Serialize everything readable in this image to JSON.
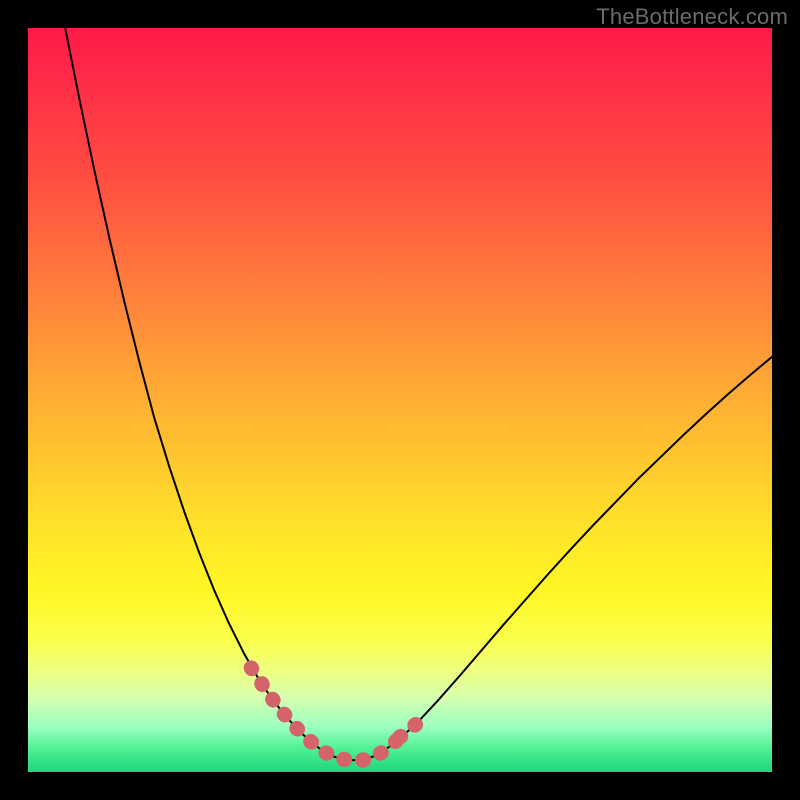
{
  "watermark": {
    "text": "TheBottleneck.com"
  },
  "colors": {
    "background": "#000000",
    "curve_stroke": "#000000",
    "highlight_stroke": "#d4646a",
    "gradient_top": "#ff1a49",
    "gradient_bottom": "#1fd47c"
  },
  "chart_data": {
    "type": "line",
    "title": "",
    "xlabel": "",
    "ylabel": "",
    "xlim": [
      0,
      100
    ],
    "ylim": [
      0,
      100
    ],
    "x": [
      5,
      7,
      9,
      11,
      13,
      15,
      17,
      19,
      21,
      23,
      25,
      27,
      29,
      31,
      32,
      33,
      34,
      35,
      36,
      37,
      38,
      39,
      40,
      41,
      42,
      43,
      45,
      47,
      49,
      52,
      55,
      58,
      61,
      64,
      67,
      70,
      73,
      76,
      79,
      82,
      85,
      88,
      91,
      94,
      97,
      100
    ],
    "values": [
      100,
      90,
      80.5,
      71.5,
      63,
      55,
      47.5,
      41,
      35,
      29.5,
      24.5,
      20,
      16,
      12.5,
      11,
      9.6,
      8.3,
      7.1,
      6,
      5,
      4.1,
      3.3,
      2.6,
      2.1,
      1.8,
      1.6,
      1.6,
      2.3,
      3.7,
      6.3,
      9.5,
      12.9,
      16.4,
      19.9,
      23.3,
      26.7,
      30,
      33.2,
      36.3,
      39.4,
      42.3,
      45.2,
      48,
      50.7,
      53.3,
      55.8
    ],
    "highlight_segments": [
      {
        "x": [
          30,
          31,
          32,
          33,
          34,
          35,
          36,
          37,
          38
        ],
        "values": [
          14,
          12.5,
          11,
          9.6,
          8.3,
          7.1,
          6,
          5,
          4.1
        ]
      },
      {
        "x": [
          38,
          39,
          40,
          41,
          42,
          43,
          44,
          45
        ],
        "values": [
          4.1,
          3.3,
          2.6,
          2.1,
          1.8,
          1.6,
          1.5,
          1.6
        ]
      },
      {
        "x": [
          45,
          46,
          47,
          48,
          49,
          50
        ],
        "values": [
          1.6,
          1.9,
          2.3,
          2.9,
          3.7,
          4.7
        ]
      },
      {
        "x": [
          50,
          51,
          52,
          53
        ],
        "values": [
          4.7,
          5.5,
          6.3,
          7.2
        ]
      }
    ],
    "annotations": []
  }
}
